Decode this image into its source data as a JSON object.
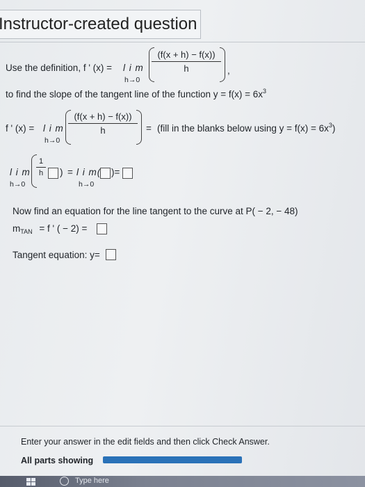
{
  "title": "Instructor-created question",
  "line1": {
    "prefix": "Use the definition, f ' (x) = ",
    "lim": "l i m",
    "lim_sub": "h→0",
    "numerator": "(f(x + h) − f(x))",
    "denominator": "h",
    "suffix": ","
  },
  "line2": {
    "text": "to find the slope of the tangent line of the function y = f(x) = 6x",
    "exponent": "3"
  },
  "line3": {
    "prefix": "f ' (x) = ",
    "lim": "l i m",
    "lim_sub": "h→0",
    "numerator": "(f(x + h) − f(x))",
    "denominator": "h",
    "eq": "=",
    "hint": "(fill in the blanks below using y = f(x) = 6x",
    "hint_exp": "3",
    "hint_close": ")"
  },
  "line4": {
    "lim1": "l i m",
    "lim_sub1": "h→0",
    "frac_num": "1",
    "frac_den": "h",
    "close": ")",
    "eq": "=",
    "lim2": "l i m(",
    "lim_sub2": "h→0",
    "close2": ")=",
    "blank_values": [
      "",
      "",
      ""
    ]
  },
  "tangent_prompt": "Now find an equation for the line tangent to the curve at P( − 2, − 48)",
  "mtan": {
    "m": "m",
    "sub": "TAN",
    "text": "= f ' ( − 2) =",
    "value": ""
  },
  "tangent_eq": {
    "label": "Tangent equation: y=",
    "value": ""
  },
  "instruction": "Enter your answer in the edit fields and then click Check Answer.",
  "parts_label": "All parts showing",
  "progress": 1.0,
  "taskbar": {
    "search_text": "Type here"
  }
}
